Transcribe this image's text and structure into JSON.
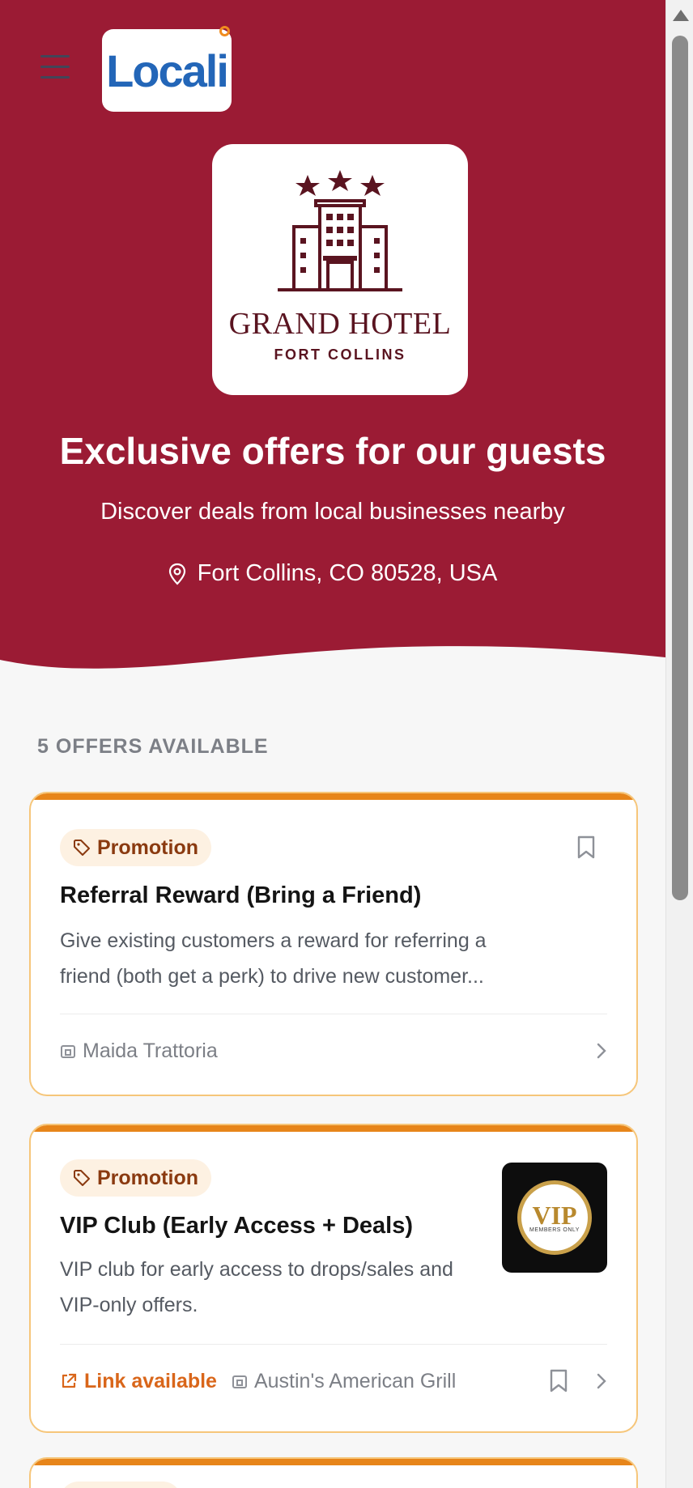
{
  "header": {
    "brand_logo_text": "Locali"
  },
  "hotel": {
    "name": "GRAND HOTEL",
    "city": "FORT COLLINS"
  },
  "hero": {
    "title": "Exclusive offers for our guests",
    "subtitle": "Discover deals from local businesses nearby",
    "location": "Fort Collins, CO 80528, USA"
  },
  "offers_count_label": "5 OFFERS AVAILABLE",
  "offers": [
    {
      "tag": "Promotion",
      "title": "Referral Reward (Bring a Friend)",
      "description": "Give existing customers a reward for referring a friend (both get a perk) to drive new customer...",
      "merchant": "Maida Trattoria"
    },
    {
      "tag": "Promotion",
      "title": "VIP Club (Early Access + Deals)",
      "description": "VIP club for early access to drops/sales and VIP-only offers.",
      "link_label": "Link available",
      "merchant": "Austin's American Grill",
      "image_text": "VIP",
      "image_subtext": "MEMBERS ONLY"
    }
  ],
  "colors": {
    "hero_bg": "#9b1b34",
    "accent_orange": "#e7851a",
    "brand_blue": "#2366b8",
    "hotel_maroon": "#5a1420"
  }
}
